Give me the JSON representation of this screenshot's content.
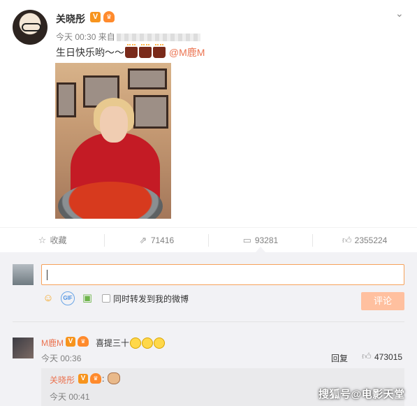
{
  "post": {
    "author": "关晓彤",
    "verified_badge": "V",
    "time_label": "今天 00:30 来自",
    "text_before": "生日快乐哟～～",
    "cake_emoji_count": 3,
    "mention": "@M鹿M"
  },
  "actions": [
    {
      "id": "favorite",
      "icon": "star-icon",
      "label": "收藏"
    },
    {
      "id": "repost",
      "icon": "repost-icon",
      "label": "71416"
    },
    {
      "id": "comment",
      "icon": "comment-icon",
      "label": "93281"
    },
    {
      "id": "like",
      "icon": "thumb-up-icon",
      "label": "2355224"
    }
  ],
  "composer": {
    "repost_label": "同时转发到我的微博",
    "submit_label": "评论",
    "gif_label": "GIF"
  },
  "comment": {
    "author": "M鹿M",
    "text": "喜提三十",
    "time": "今天 00:36",
    "reply_label": "回复",
    "like_count": "473015",
    "reply": {
      "author": "关晓彤",
      "colon": ":",
      "time": "今天 00:41"
    }
  },
  "watermark": "搜狐号@电影天堂",
  "colors": {
    "accent": "#eb7350",
    "submit_disabled": "#ffc09f",
    "badge": "#f7941d",
    "panel_bg": "#f2f2f5"
  }
}
